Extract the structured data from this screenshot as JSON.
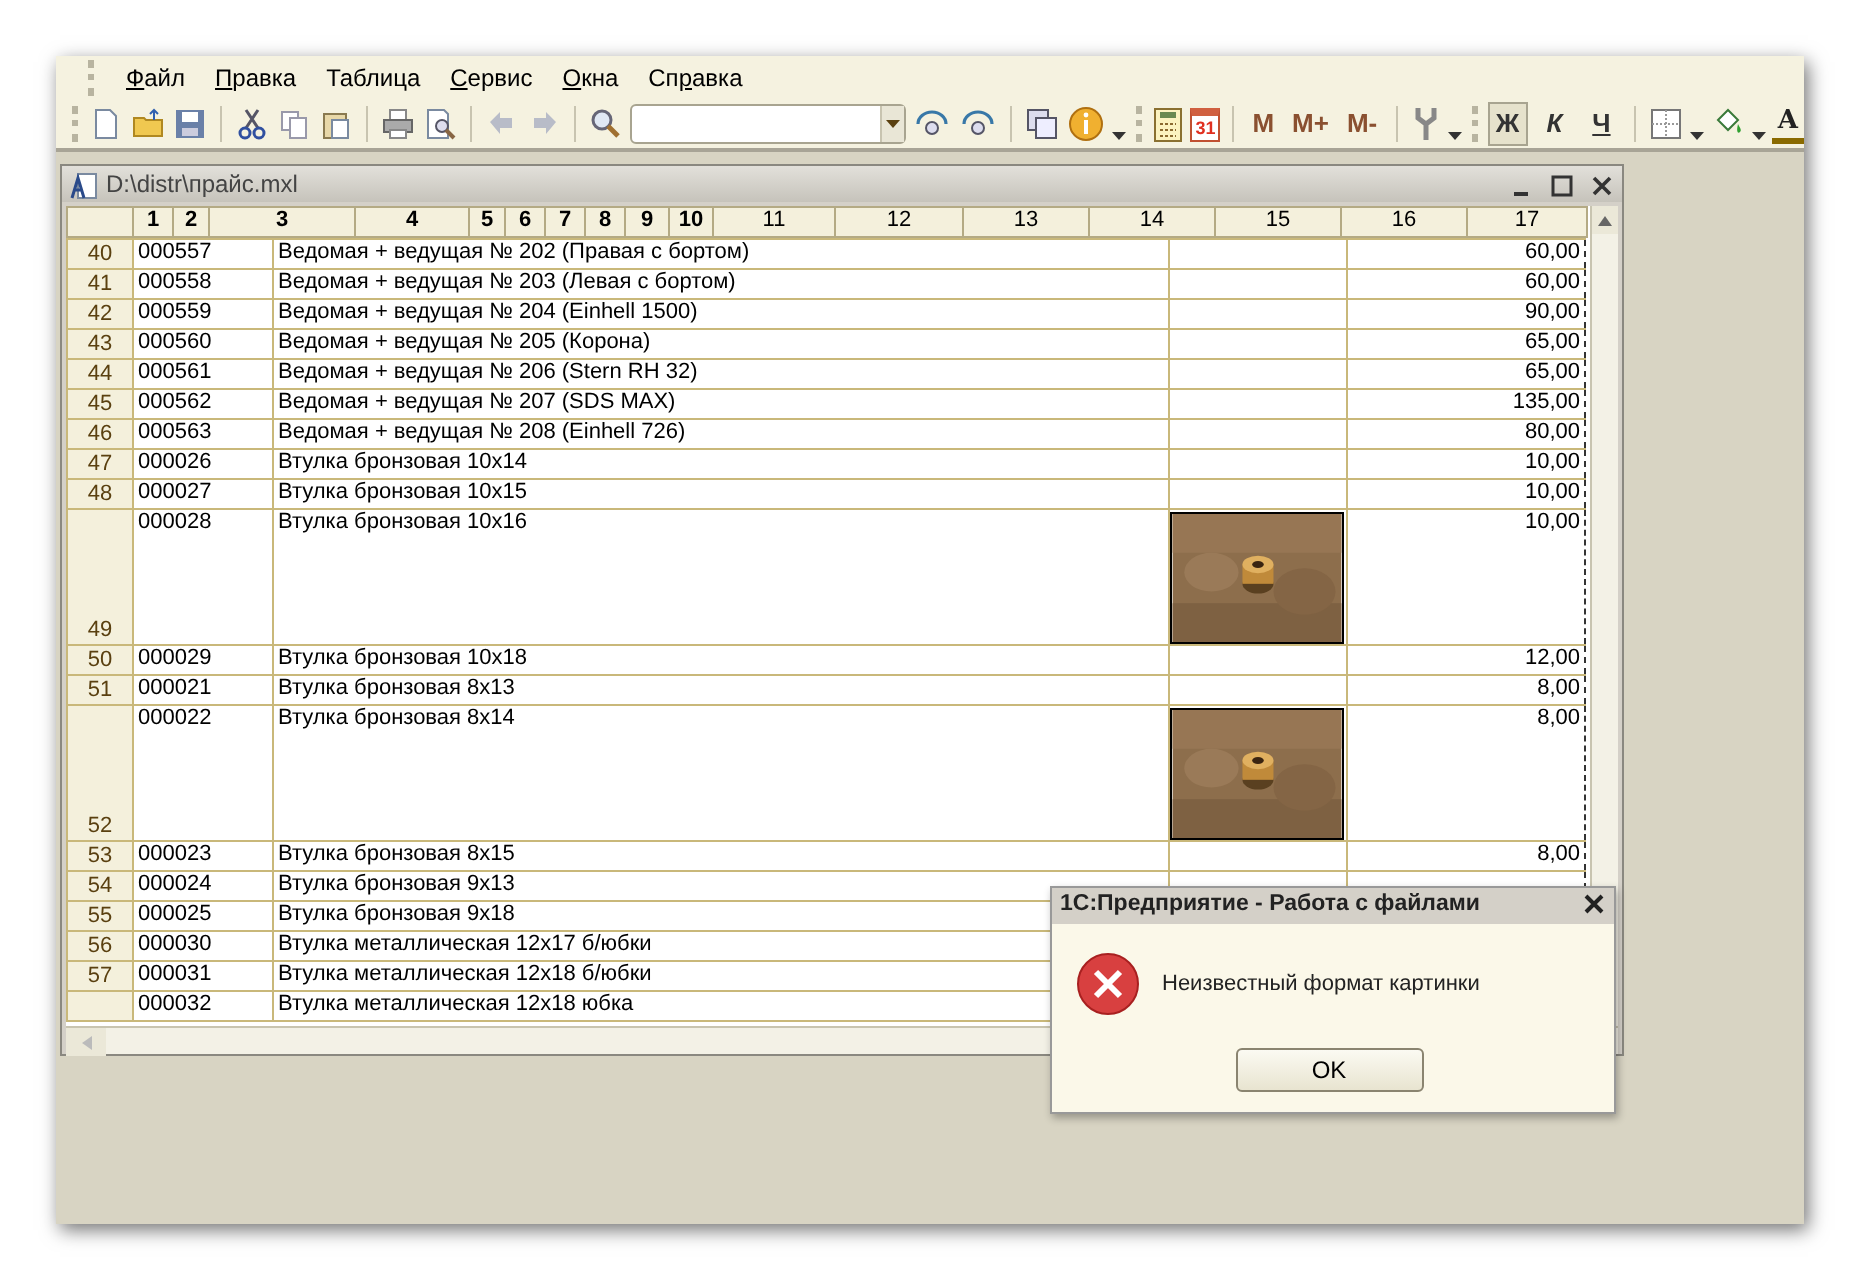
{
  "menu": [
    {
      "hotkey": "Ф",
      "rest": "айл"
    },
    {
      "hotkey": "П",
      "rest": "равка"
    },
    {
      "rest": "Таблица"
    },
    {
      "hotkey": "С",
      "rest": "ервис"
    },
    {
      "hotkey": "О",
      "rest": "кна"
    },
    {
      "before": "Сп",
      "hotkey": "р",
      "rest": "авка"
    }
  ],
  "toolbar": {
    "calendar_label": "31",
    "memory_buttons": [
      {
        "label": "M"
      },
      {
        "label": "M+"
      },
      {
        "label": "M-"
      }
    ],
    "format_buttons": [
      {
        "label": "Ж",
        "pressed": true,
        "kind": "bold"
      },
      {
        "label": "К",
        "pressed": false,
        "kind": "italic"
      },
      {
        "label": "Ч",
        "pressed": false,
        "kind": "underline"
      }
    ],
    "text_color_label": "A"
  },
  "document": {
    "title": "D:\\distr\\прайс.mxl",
    "columns": [
      {
        "label": "1",
        "highlighted": true
      },
      {
        "label": "2",
        "highlighted": true
      },
      {
        "label": "3",
        "highlighted": true
      },
      {
        "label": "4",
        "highlighted": true
      },
      {
        "label": "5",
        "highlighted": true
      },
      {
        "label": "6",
        "highlighted": true
      },
      {
        "label": "7",
        "highlighted": true
      },
      {
        "label": "8",
        "highlighted": true
      },
      {
        "label": "9",
        "highlighted": true
      },
      {
        "label": "10",
        "highlighted": true
      },
      {
        "label": "11",
        "highlighted": false
      },
      {
        "label": "12",
        "highlighted": false
      },
      {
        "label": "13",
        "highlighted": false
      },
      {
        "label": "14",
        "highlighted": false
      },
      {
        "label": "15",
        "highlighted": false
      },
      {
        "label": "16",
        "highlighted": false
      },
      {
        "label": "17",
        "highlighted": false
      }
    ],
    "rows": [
      {
        "number": "40",
        "code": "000557",
        "name": "Ведомая + ведущая № 202 (Правая с бортом)",
        "price": "60,00",
        "kind": "text"
      },
      {
        "number": "41",
        "code": "000558",
        "name": "Ведомая + ведущая № 203 (Левая с бортом)",
        "price": "60,00",
        "kind": "text"
      },
      {
        "number": "42",
        "code": "000559",
        "name": "Ведомая + ведущая № 204 (Einhell 1500)",
        "price": "90,00",
        "kind": "text"
      },
      {
        "number": "43",
        "code": "000560",
        "name": "Ведомая + ведущая № 205 (Корона)",
        "price": "65,00",
        "kind": "text"
      },
      {
        "number": "44",
        "code": "000561",
        "name": "Ведомая + ведущая № 206 (Stern RH 32)",
        "price": "65,00",
        "kind": "text"
      },
      {
        "number": "45",
        "code": "000562",
        "name": "Ведомая + ведущая № 207 (SDS MAX)",
        "price": "135,00",
        "kind": "text"
      },
      {
        "number": "46",
        "code": "000563",
        "name": "Ведомая + ведущая № 208 (Einhell 726)",
        "price": "80,00",
        "kind": "text"
      },
      {
        "number": "47",
        "code": "000026",
        "name": "Втулка бронзовая 10x14",
        "price": "10,00",
        "kind": "text"
      },
      {
        "number": "48",
        "code": "000027",
        "name": "Втулка бронзовая 10x15",
        "price": "10,00",
        "kind": "text"
      },
      {
        "number": "49",
        "code": "000028",
        "name": "Втулка бронзовая 10x16",
        "price": "10,00",
        "kind": "picture"
      },
      {
        "number": "50",
        "code": "000029",
        "name": "Втулка бронзовая 10x18",
        "price": "12,00",
        "kind": "text"
      },
      {
        "number": "51",
        "code": "000021",
        "name": "Втулка бронзовая 8x13",
        "price": "8,00",
        "kind": "text"
      },
      {
        "number": "52",
        "code": "000022",
        "name": "Втулка бронзовая 8x14",
        "price": "8,00",
        "kind": "picture"
      },
      {
        "number": "53",
        "code": "000023",
        "name": "Втулка бронзовая 8x15",
        "price": "8,00",
        "kind": "text"
      },
      {
        "number": "54",
        "code": "000024",
        "name": "Втулка бронзовая 9x13",
        "kind": "text"
      },
      {
        "number": "55",
        "code": "000025",
        "name": "Втулка бронзовая 9x18",
        "kind": "text"
      },
      {
        "number": "56",
        "code": "000030",
        "name": "Втулка металлическая 12x17 б/юбки",
        "kind": "text"
      },
      {
        "number": "57",
        "code": "000031",
        "name": "Втулка металлическая 12x18 б/юбки",
        "kind": "text"
      },
      {
        "code": "000032",
        "name": "Втулка металлическая 12x18 юбка",
        "kind": "text"
      }
    ]
  },
  "dialog": {
    "title": "1С:Предприятие - Работа с файлами",
    "message": "Неизвестный формат картинки",
    "button": "OK"
  }
}
